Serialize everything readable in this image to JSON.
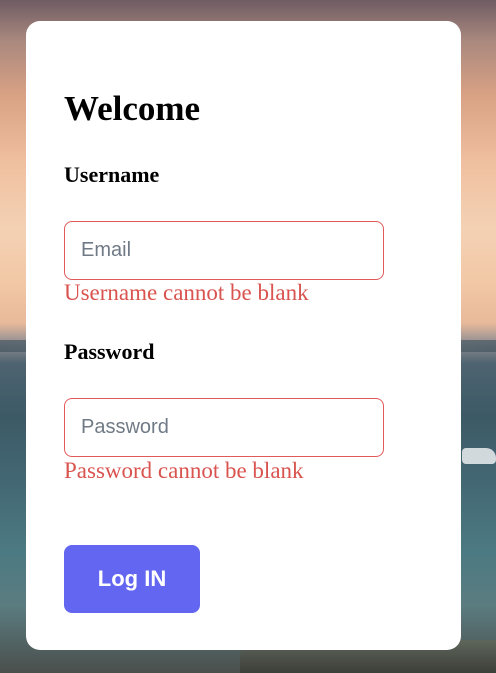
{
  "form": {
    "title": "Welcome",
    "username": {
      "label": "Username",
      "placeholder": "Email",
      "value": "",
      "error": "Username cannot be blank"
    },
    "password": {
      "label": "Password",
      "placeholder": "Password",
      "value": "",
      "error": "Password cannot be blank"
    },
    "submit_label": "Log IN"
  },
  "colors": {
    "accent": "#6366f1",
    "error": "#d9534f",
    "card": "#ffffff"
  }
}
